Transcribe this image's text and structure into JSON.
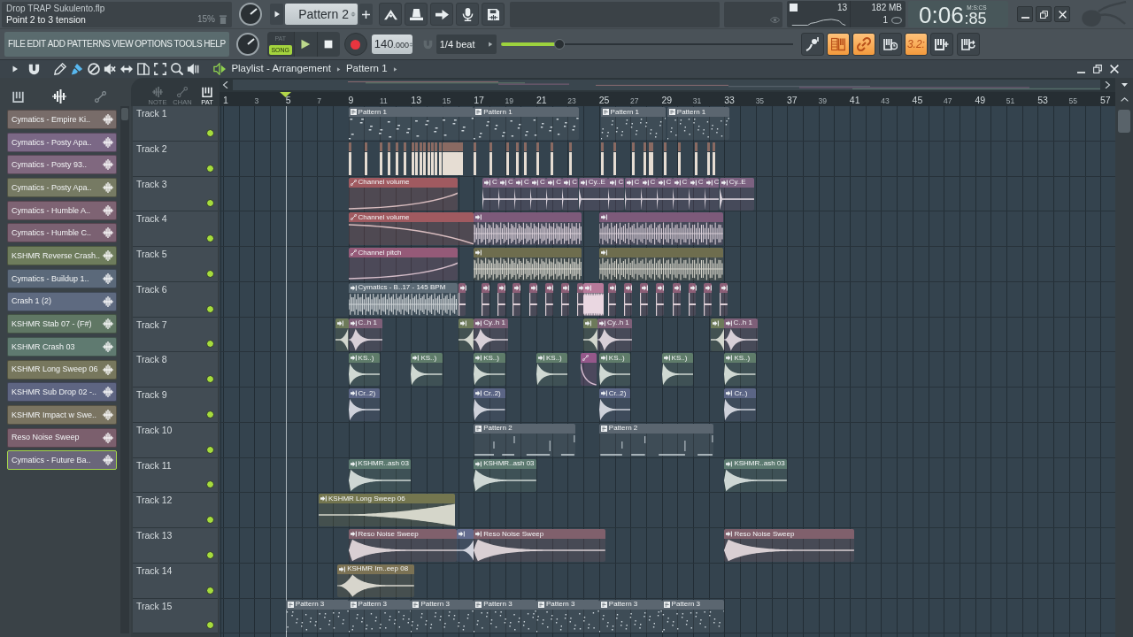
{
  "title_bar": {
    "project": "Drop TRAP Sukulento.flp",
    "hint": "Point 2 to 3 tension",
    "cpu": "15%"
  },
  "pattern_picker": {
    "value": "Pattern 2"
  },
  "monitor": {
    "cpu": "13",
    "memory": "182 MB",
    "voices": "1"
  },
  "clock": {
    "time": "0:06",
    "centiseconds": ":85",
    "format": "M:S:CS"
  },
  "menu": [
    "FILE",
    "EDIT",
    "ADD",
    "PATTERNS",
    "VIEW",
    "OPTIONS",
    "TOOLS",
    "HELP"
  ],
  "transport": {
    "modes": [
      {
        "label": "PAT",
        "selected": false
      },
      {
        "label": "SONG",
        "selected": true
      }
    ],
    "tempo": "140",
    "tempo_fraction": ".000",
    "snap": "1/4 beat",
    "position": {
      "level": 0.2
    }
  },
  "toolbar": [
    {
      "kind": "note",
      "on": false
    },
    {
      "kind": "piano_roll",
      "on": true
    },
    {
      "kind": "link",
      "on": true
    },
    {
      "kind": "keys_clock",
      "on": false
    },
    {
      "kind": "countdown",
      "label": "3.2:",
      "on": true
    },
    {
      "kind": "keys_add",
      "on": false
    },
    {
      "kind": "keys_loop",
      "on": false
    }
  ],
  "playlist": {
    "title": "Playlist - Arrangement",
    "pattern": "Pattern 1",
    "tools": [
      {
        "kind": "draw",
        "selected": false
      },
      {
        "kind": "paint",
        "selected": true
      },
      {
        "kind": "delete",
        "selected": false
      },
      {
        "kind": "mute",
        "selected": false
      },
      {
        "kind": "slip",
        "selected": false
      },
      {
        "kind": "slice",
        "selected": false
      },
      {
        "kind": "select",
        "selected": false
      },
      {
        "kind": "zoom",
        "selected": false
      },
      {
        "kind": "playback",
        "selected": false
      }
    ],
    "filters": [
      {
        "kind": "note",
        "label": "NOTE",
        "selected": false
      },
      {
        "kind": "channel",
        "label": "CHAN",
        "selected": false
      },
      {
        "kind": "pattern",
        "label": "PAT",
        "selected": true
      }
    ],
    "ruler": [
      "1",
      "3",
      "5",
      "7",
      "9",
      "11",
      "13",
      "15",
      "17",
      "19",
      "21",
      "23",
      "25",
      "27",
      "29",
      "31",
      "33",
      "35",
      "37",
      "39",
      "41",
      "43",
      "45",
      "47",
      "49",
      "51",
      "53",
      "55",
      "57"
    ]
  },
  "clip_list": [
    {
      "name": "Cymatics - Empire Ki..",
      "color": "#786c69",
      "selected": false
    },
    {
      "name": "Cymatics - Posty Apa..",
      "color": "#7b6886",
      "selected": false
    },
    {
      "name": "Cymatics - Posty 93..",
      "color": "#80687f",
      "selected": false
    },
    {
      "name": "Cymatics - Posty Apa..",
      "color": "#767a63",
      "selected": false
    },
    {
      "name": "Cymatics - Humble A..",
      "color": "#7e6373",
      "selected": false
    },
    {
      "name": "Cymatics - Humble C..",
      "color": "#7b6172",
      "selected": false
    },
    {
      "name": "KSHMR Reverse Crash..",
      "color": "#6e7c5c",
      "selected": false
    },
    {
      "name": "Cymatics - Buildup 1..",
      "color": "#5b697a",
      "selected": false
    },
    {
      "name": "Crash 1 (2)",
      "color": "#5e6a80",
      "selected": false
    },
    {
      "name": "KSHMR Stab 07 - (F#)",
      "color": "#607764",
      "selected": false
    },
    {
      "name": "KSHMR Crash 03",
      "color": "#5f7a70",
      "selected": false
    },
    {
      "name": "KSHMR Long Sweep 06",
      "color": "#77775d",
      "selected": false
    },
    {
      "name": "KSHMR Sub Drop 02 -..",
      "color": "#5e6582",
      "selected": false
    },
    {
      "name": "KSHMR Impact w Swe..",
      "color": "#7a7461",
      "selected": false
    },
    {
      "name": "Reso Noise Sweep",
      "color": "#7b5f6d",
      "selected": false
    },
    {
      "name": "Cymatics - Future Ba..",
      "color": "#6a667a",
      "selected": true
    }
  ],
  "tracks": [
    {
      "name": "Track 1",
      "enabled": true,
      "clips": [
        {
          "kind": "pattern",
          "label": "Pattern 1",
          "color": "#5b6670"
        },
        {
          "kind": "pattern",
          "label": "Pattern 1",
          "color": "#5b6670"
        },
        {
          "kind": "pattern",
          "label": "Pattern 1",
          "color": "#5b6670"
        },
        {
          "kind": "pattern",
          "label": "Pattern 1",
          "color": "#5b6670"
        }
      ]
    },
    {
      "name": "Track 2",
      "enabled": true,
      "clips": [
        {
          "kind": "hits",
          "color": "#8a6a62"
        },
        {
          "kind": "hits",
          "color": "#8a6a62"
        },
        {
          "kind": "hits",
          "color": "#8a6a62"
        }
      ]
    },
    {
      "name": "Track 3",
      "enabled": true,
      "clips": [
        {
          "kind": "automation",
          "label": "Channel volume",
          "color": "#a05a60"
        },
        {
          "kind": "audio",
          "label": "C",
          "color": "#7c6180"
        },
        {
          "kind": "audio",
          "label": "C",
          "color": "#7c6180"
        },
        {
          "kind": "audio",
          "label": "C",
          "color": "#7c6180"
        },
        {
          "kind": "audio",
          "label": "C",
          "color": "#7c6180"
        },
        {
          "kind": "audio",
          "label": "C",
          "color": "#7c6180"
        },
        {
          "kind": "audio",
          "label": "C",
          "color": "#7c6180"
        },
        {
          "kind": "audio",
          "label": "Cy..E",
          "color": "#7c6180"
        },
        {
          "kind": "audio",
          "label": "C",
          "color": "#7c6180"
        },
        {
          "kind": "audio",
          "label": "C",
          "color": "#7c6180"
        },
        {
          "kind": "audio",
          "label": "C",
          "color": "#7c6180"
        },
        {
          "kind": "audio",
          "label": "C",
          "color": "#7c6180"
        },
        {
          "kind": "audio",
          "label": "C",
          "color": "#7c6180"
        },
        {
          "kind": "audio",
          "label": "C",
          "color": "#7c6180"
        },
        {
          "kind": "audio",
          "label": "C",
          "color": "#7c6180"
        },
        {
          "kind": "audio",
          "label": "Cy..E",
          "color": "#7c6180"
        }
      ]
    },
    {
      "name": "Track 4",
      "enabled": true,
      "clips": [
        {
          "kind": "automation",
          "label": "Channel volume",
          "color": "#a05a60"
        },
        {
          "kind": "audio",
          "color": "#7d5a7a"
        },
        {
          "kind": "audio",
          "color": "#7d5a7a"
        }
      ]
    },
    {
      "name": "Track 5",
      "enabled": true,
      "clips": [
        {
          "kind": "automation",
          "label": "Channel pitch",
          "color": "#955a78"
        },
        {
          "kind": "audio",
          "color": "#6e6d4e"
        },
        {
          "kind": "audio",
          "color": "#6e6d4e"
        }
      ]
    },
    {
      "name": "Track 6",
      "enabled": true,
      "clips": [
        {
          "kind": "audio",
          "label": "Cymatics - B..17 - 145 BPM",
          "color": "#5d6c77"
        },
        {
          "kind": "audio",
          "color": "#8c5e76"
        },
        {
          "kind": "audio",
          "color": "#8c5e76"
        },
        {
          "kind": "audio",
          "color": "#8c5e76"
        },
        {
          "kind": "audio",
          "color": "#8c5e76"
        },
        {
          "kind": "audio",
          "color": "#8c5e76"
        },
        {
          "kind": "audio",
          "color": "#8c5e76"
        },
        {
          "kind": "audio",
          "color": "#8c5e76"
        },
        {
          "kind": "audio",
          "color": "#8c5e76"
        },
        {
          "kind": "audio",
          "color": "#b87a9a"
        },
        {
          "kind": "audio",
          "color": "#8c5e76"
        },
        {
          "kind": "audio",
          "color": "#8c5e76"
        },
        {
          "kind": "audio",
          "color": "#8c5e76"
        },
        {
          "kind": "audio",
          "color": "#8c5e76"
        },
        {
          "kind": "audio",
          "color": "#8c5e76"
        },
        {
          "kind": "audio",
          "color": "#8c5e76"
        },
        {
          "kind": "audio",
          "color": "#8c5e76"
        },
        {
          "kind": "audio",
          "color": "#8c5e76"
        }
      ]
    },
    {
      "name": "Track 7",
      "enabled": true,
      "clips": [
        {
          "kind": "audio",
          "color": "#6d7a5a"
        },
        {
          "kind": "audio",
          "label": "C..h 1",
          "color": "#7e5f78"
        },
        {
          "kind": "audio",
          "color": "#6d7a5a"
        },
        {
          "kind": "audio",
          "label": "Cy..h 1",
          "color": "#7e5f78"
        },
        {
          "kind": "audio",
          "color": "#6d7a5a"
        },
        {
          "kind": "audio",
          "label": "Cy..h 1",
          "color": "#7e5f78"
        },
        {
          "kind": "audio",
          "color": "#6d7a5a"
        },
        {
          "kind": "audio",
          "label": "C..h 1",
          "color": "#7e5f78"
        }
      ]
    },
    {
      "name": "Track 8",
      "enabled": true,
      "clips": [
        {
          "kind": "audio",
          "label": "KS..)",
          "color": "#5f7c6a"
        },
        {
          "kind": "audio",
          "label": "KS..)",
          "color": "#5f7c6a"
        },
        {
          "kind": "audio",
          "label": "KS..)",
          "color": "#5f7c6a"
        },
        {
          "kind": "audio",
          "label": "KS..)",
          "color": "#5f7c6a"
        },
        {
          "kind": "automation",
          "color": "#95588a"
        },
        {
          "kind": "audio",
          "label": "KS..)",
          "color": "#5f7c6a"
        },
        {
          "kind": "audio",
          "label": "KS..)",
          "color": "#5f7c6a"
        },
        {
          "kind": "audio",
          "label": "KS..)",
          "color": "#5f7c6a"
        }
      ]
    },
    {
      "name": "Track 9",
      "enabled": true,
      "clips": [
        {
          "kind": "audio",
          "label": "Cr..2)",
          "color": "#5b6585"
        },
        {
          "kind": "audio",
          "label": "Cr..2)",
          "color": "#5b6585"
        },
        {
          "kind": "audio",
          "label": "Cr..2)",
          "color": "#5b6585"
        },
        {
          "kind": "audio",
          "label": "Cr..)",
          "color": "#5b6585"
        }
      ]
    },
    {
      "name": "Track 10",
      "enabled": true,
      "clips": [
        {
          "kind": "pattern",
          "label": "Pattern 2",
          "color": "#5b6670"
        },
        {
          "kind": "pattern",
          "label": "Pattern 2",
          "color": "#5b6670"
        }
      ]
    },
    {
      "name": "Track 11",
      "enabled": true,
      "clips": [
        {
          "kind": "audio",
          "label": "KSHMR..ash 03",
          "color": "#5c7a70"
        },
        {
          "kind": "audio",
          "label": "KSHMR..ash 03",
          "color": "#5c7a70"
        },
        {
          "kind": "audio",
          "label": "KSHMR..ash 03",
          "color": "#5c7a70"
        }
      ]
    },
    {
      "name": "Track 12",
      "enabled": true,
      "clips": [
        {
          "kind": "audio",
          "label": "KSHMR Long Sweep 06",
          "color": "#74764f"
        }
      ]
    },
    {
      "name": "Track 13",
      "enabled": true,
      "clips": [
        {
          "kind": "audio",
          "label": "Reso Noise Sweep",
          "color": "#80606c"
        },
        {
          "kind": "audio",
          "color": "#646c8e"
        },
        {
          "kind": "audio",
          "label": "Reso Noise Sweep",
          "color": "#80606c"
        },
        {
          "kind": "audio",
          "label": "Reso Noise Sweep",
          "color": "#80606c"
        }
      ]
    },
    {
      "name": "Track 14",
      "enabled": true,
      "clips": [
        {
          "kind": "audio",
          "label": "KSHMR Im..eep 08",
          "color": "#7b7254"
        }
      ]
    },
    {
      "name": "Track 15",
      "enabled": true,
      "clips": [
        {
          "kind": "pattern",
          "label": "Pattern 3",
          "color": "#5b6670"
        },
        {
          "kind": "pattern",
          "label": "Pattern 3",
          "color": "#5b6670"
        },
        {
          "kind": "pattern",
          "label": "Pattern 3",
          "color": "#5b6670"
        },
        {
          "kind": "pattern",
          "label": "Pattern 3",
          "color": "#5b6670"
        },
        {
          "kind": "pattern",
          "label": "Pattern 3",
          "color": "#5b6670"
        },
        {
          "kind": "pattern",
          "label": "Pattern 3",
          "color": "#5b6670"
        },
        {
          "kind": "pattern",
          "label": "Pattern 3",
          "color": "#5b6670"
        }
      ]
    }
  ]
}
